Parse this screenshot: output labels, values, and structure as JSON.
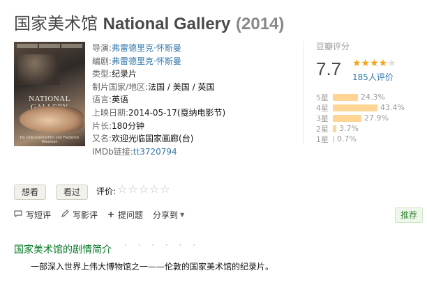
{
  "header": {
    "title_cn": "国家美术馆",
    "title_en": "National Gallery",
    "year": "(2014)"
  },
  "poster": {
    "title_text": "NATIONAL GALLERY",
    "subtitle_text": "Ein Dokumentarfilm von Frederick Wiseman"
  },
  "info": {
    "director_label": "导演:",
    "director": "弗雷德里克·怀斯曼",
    "writer_label": "编剧:",
    "writer": "弗雷德里克·怀斯曼",
    "genre_label": "类型:",
    "genre": "纪录片",
    "country_label": "制片国家/地区:",
    "country": "法国 / 美国 / 英国",
    "language_label": "语言:",
    "language": "英语",
    "release_label": "上映日期:",
    "release": "2014-05-17(戛纳电影节)",
    "runtime_label": "片长:",
    "runtime": "180分钟",
    "aka_label": "又名:",
    "aka": "欢迎光临国家画廊(台)",
    "imdb_label": "IMDb链接:",
    "imdb": "tt3720794"
  },
  "rating": {
    "title": "豆瓣评分",
    "score": "7.7",
    "stars_full": "★★★★",
    "stars_empty": "★",
    "votes": "185人评价",
    "distribution": [
      {
        "label": "5星",
        "pct": "24.3%",
        "value": 24.3
      },
      {
        "label": "4星",
        "pct": "43.4%",
        "value": 43.4
      },
      {
        "label": "3星",
        "pct": "27.9%",
        "value": 27.9
      },
      {
        "label": "2星",
        "pct": "3.7%",
        "value": 3.7
      },
      {
        "label": "1星",
        "pct": "0.7%",
        "value": 0.7
      }
    ],
    "bar_color": "#ffd596"
  },
  "controls": {
    "want_label": "想看",
    "seen_label": "看过",
    "rate_label": "评价:",
    "rate_stars": "☆☆☆☆☆"
  },
  "actions": {
    "short_review": "写短评",
    "review": "写影评",
    "question": "提问题",
    "share": "分享到",
    "share_arrow": "▼",
    "recommend": "推荐"
  },
  "synopsis": {
    "title": "国家美术馆的剧情简介",
    "dots": "· · · · · ·",
    "text": "一部深入世界上伟大博物馆之一——伦敦的国家美术馆的纪录片。"
  },
  "colors": {
    "link": "#3377aa",
    "accent_green": "#007722",
    "star": "#f4a314"
  }
}
